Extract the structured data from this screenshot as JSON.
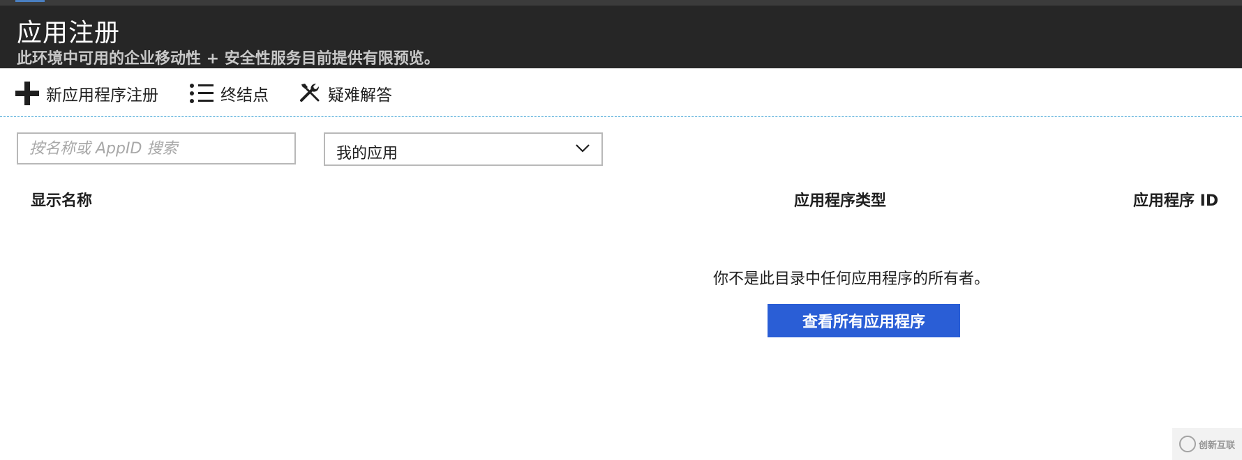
{
  "header": {
    "title": "应用注册",
    "subtitle": "此环境中可用的企业移动性 + 安全性服务目前提供有限预览。"
  },
  "toolbar": {
    "new_registration_label": "新应用程序注册",
    "endpoints_label": "终结点",
    "troubleshoot_label": "疑难解答"
  },
  "filters": {
    "search_placeholder": "按名称或 AppID 搜索",
    "search_value": "",
    "app_filter_selected": "我的应用"
  },
  "table": {
    "columns": [
      "显示名称",
      "应用程序类型",
      "应用程序 ID"
    ],
    "rows": []
  },
  "empty_state": {
    "message": "你不是此目录中任何应用程序的所有者。",
    "button_label": "查看所有应用程序"
  },
  "watermark": {
    "text": "创新互联"
  },
  "colors": {
    "header_bg": "#262626",
    "primary_button": "#2a5ed6",
    "divider": "#4aa8d8"
  },
  "icons": {
    "new_registration": "plus-icon",
    "endpoints": "list-icon",
    "troubleshoot": "wrench-screwdriver-icon",
    "select_chevron": "chevron-down-icon"
  }
}
